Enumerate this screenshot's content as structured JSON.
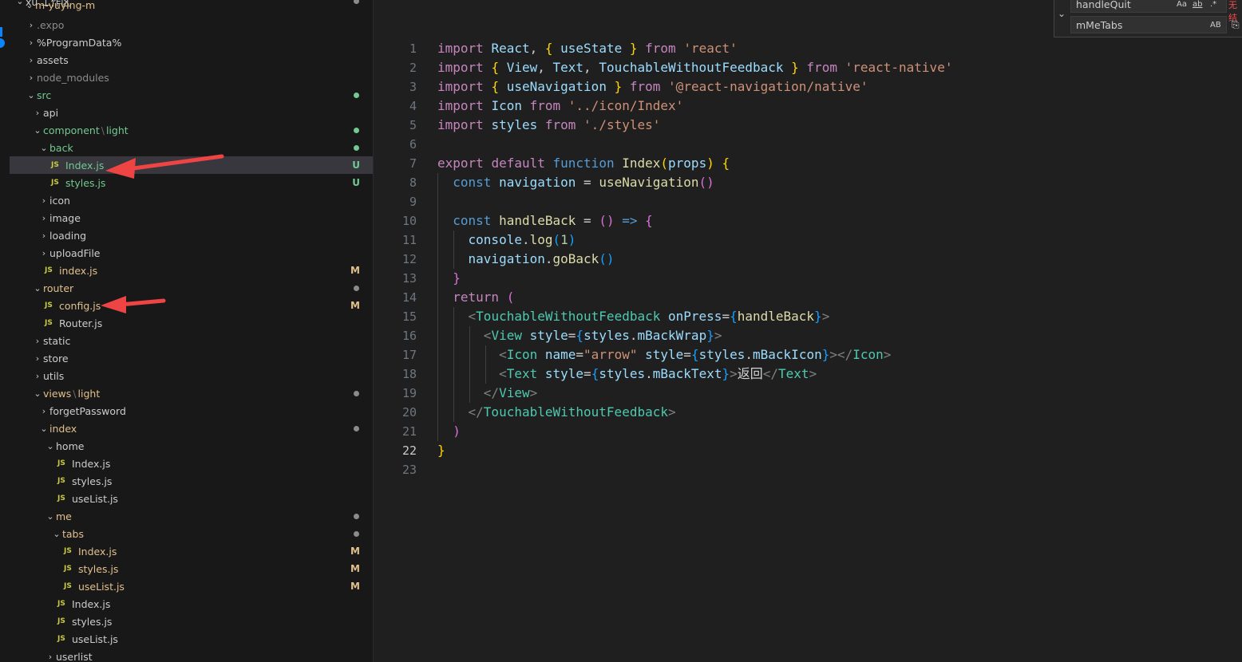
{
  "explorer": {
    "root_label": "xü 工作区",
    "project": "m-yuying-m",
    "items": [
      {
        "name": ".expo",
        "type": "folder",
        "expanded": false,
        "depth": 1,
        "color": "dim"
      },
      {
        "name": "%ProgramData%",
        "type": "folder",
        "expanded": false,
        "depth": 1,
        "color": "white"
      },
      {
        "name": "assets",
        "type": "folder",
        "expanded": false,
        "depth": 1,
        "color": "white"
      },
      {
        "name": "node_modules",
        "type": "folder",
        "expanded": false,
        "depth": 1,
        "color": "dim"
      },
      {
        "name": "src",
        "type": "folder",
        "expanded": true,
        "depth": 1,
        "color": "green",
        "dot": "#73c991"
      },
      {
        "name": "api",
        "type": "folder",
        "expanded": false,
        "depth": 2,
        "color": "white"
      },
      {
        "name": "component",
        "suffix": "light",
        "type": "folder",
        "expanded": true,
        "depth": 2,
        "color": "green",
        "dot": "#73c991"
      },
      {
        "name": "back",
        "type": "folder",
        "expanded": true,
        "depth": 3,
        "color": "green",
        "dot": "#73c991"
      },
      {
        "name": "Index.js",
        "type": "file",
        "depth": 4,
        "color": "green",
        "status": "U",
        "status_color": "#73c991",
        "selected": true
      },
      {
        "name": "styles.js",
        "type": "file",
        "depth": 4,
        "color": "green",
        "status": "U",
        "status_color": "#73c991"
      },
      {
        "name": "icon",
        "type": "folder",
        "expanded": false,
        "depth": 3,
        "color": "white"
      },
      {
        "name": "image",
        "type": "folder",
        "expanded": false,
        "depth": 3,
        "color": "white"
      },
      {
        "name": "loading",
        "type": "folder",
        "expanded": false,
        "depth": 3,
        "color": "white"
      },
      {
        "name": "uploadFile",
        "type": "folder",
        "expanded": false,
        "depth": 3,
        "color": "white"
      },
      {
        "name": "index.js",
        "type": "file",
        "depth": 3,
        "color": "yellow",
        "status": "M",
        "status_color": "#e2c08d"
      },
      {
        "name": "router",
        "type": "folder",
        "expanded": true,
        "depth": 2,
        "color": "yellow",
        "dot": "#8b8b8b"
      },
      {
        "name": "config.js",
        "type": "file",
        "depth": 3,
        "color": "yellow",
        "status": "M",
        "status_color": "#e2c08d"
      },
      {
        "name": "Router.js",
        "type": "file",
        "depth": 3,
        "color": "white"
      },
      {
        "name": "static",
        "type": "folder",
        "expanded": false,
        "depth": 2,
        "color": "white"
      },
      {
        "name": "store",
        "type": "folder",
        "expanded": false,
        "depth": 2,
        "color": "white"
      },
      {
        "name": "utils",
        "type": "folder",
        "expanded": false,
        "depth": 2,
        "color": "white"
      },
      {
        "name": "views",
        "suffix": "light",
        "type": "folder",
        "expanded": true,
        "depth": 2,
        "color": "yellow",
        "dot": "#8b8b8b"
      },
      {
        "name": "forgetPassword",
        "type": "folder",
        "expanded": false,
        "depth": 3,
        "color": "white"
      },
      {
        "name": "index",
        "type": "folder",
        "expanded": true,
        "depth": 3,
        "color": "yellow",
        "dot": "#8b8b8b"
      },
      {
        "name": "home",
        "type": "folder",
        "expanded": true,
        "depth": 4,
        "color": "white"
      },
      {
        "name": "Index.js",
        "type": "file",
        "depth": 5,
        "color": "white"
      },
      {
        "name": "styles.js",
        "type": "file",
        "depth": 5,
        "color": "white"
      },
      {
        "name": "useList.js",
        "type": "file",
        "depth": 5,
        "color": "white"
      },
      {
        "name": "me",
        "type": "folder",
        "expanded": true,
        "depth": 4,
        "color": "yellow",
        "dot": "#8b8b8b"
      },
      {
        "name": "tabs",
        "type": "folder",
        "expanded": true,
        "depth": 5,
        "color": "yellow",
        "dot": "#8b8b8b"
      },
      {
        "name": "Index.js",
        "type": "file",
        "depth": 6,
        "color": "yellow",
        "status": "M",
        "status_color": "#e2c08d"
      },
      {
        "name": "styles.js",
        "type": "file",
        "depth": 6,
        "color": "yellow",
        "status": "M",
        "status_color": "#e2c08d"
      },
      {
        "name": "useList.js",
        "type": "file",
        "depth": 6,
        "color": "yellow",
        "status": "M",
        "status_color": "#e2c08d"
      },
      {
        "name": "Index.js",
        "type": "file",
        "depth": 5,
        "color": "white"
      },
      {
        "name": "styles.js",
        "type": "file",
        "depth": 5,
        "color": "white"
      },
      {
        "name": "useList.js",
        "type": "file",
        "depth": 5,
        "color": "white"
      },
      {
        "name": "userlist",
        "type": "folder",
        "expanded": false,
        "depth": 4,
        "color": "white"
      }
    ]
  },
  "find_widget": {
    "find_value": "handleQuit",
    "replace_value": "mMeTabs",
    "opt_case": "Aa",
    "opt_word": "ab",
    "opt_regex": ".*",
    "opt_preserve": "AB",
    "no_results": "无结"
  },
  "editor": {
    "current_line": 22,
    "lines": [
      [
        [
          "kw",
          "import"
        ],
        [
          "pun",
          " "
        ],
        [
          "id",
          "React"
        ],
        [
          "pun",
          ", "
        ],
        [
          "br1",
          "{"
        ],
        [
          "pun",
          " "
        ],
        [
          "id",
          "useState"
        ],
        [
          "pun",
          " "
        ],
        [
          "br1",
          "}"
        ],
        [
          "pun",
          " "
        ],
        [
          "kw",
          "from"
        ],
        [
          "pun",
          " "
        ],
        [
          "str",
          "'react'"
        ]
      ],
      [
        [
          "kw",
          "import"
        ],
        [
          "pun",
          " "
        ],
        [
          "br1",
          "{"
        ],
        [
          "pun",
          " "
        ],
        [
          "id",
          "View"
        ],
        [
          "pun",
          ", "
        ],
        [
          "id",
          "Text"
        ],
        [
          "pun",
          ", "
        ],
        [
          "id",
          "TouchableWithoutFeedback"
        ],
        [
          "pun",
          " "
        ],
        [
          "br1",
          "}"
        ],
        [
          "pun",
          " "
        ],
        [
          "kw",
          "from"
        ],
        [
          "pun",
          " "
        ],
        [
          "str",
          "'react-native'"
        ]
      ],
      [
        [
          "kw",
          "import"
        ],
        [
          "pun",
          " "
        ],
        [
          "br1",
          "{"
        ],
        [
          "pun",
          " "
        ],
        [
          "id",
          "useNavigation"
        ],
        [
          "pun",
          " "
        ],
        [
          "br1",
          "}"
        ],
        [
          "pun",
          " "
        ],
        [
          "kw",
          "from"
        ],
        [
          "pun",
          " "
        ],
        [
          "str",
          "'@react-navigation/native'"
        ]
      ],
      [
        [
          "kw",
          "import"
        ],
        [
          "pun",
          " "
        ],
        [
          "id",
          "Icon"
        ],
        [
          "pun",
          " "
        ],
        [
          "kw",
          "from"
        ],
        [
          "pun",
          " "
        ],
        [
          "str",
          "'../icon/Index'"
        ]
      ],
      [
        [
          "kw",
          "import"
        ],
        [
          "pun",
          " "
        ],
        [
          "id",
          "styles"
        ],
        [
          "pun",
          " "
        ],
        [
          "kw",
          "from"
        ],
        [
          "pun",
          " "
        ],
        [
          "str",
          "'./styles'"
        ]
      ],
      [],
      [
        [
          "kw",
          "export"
        ],
        [
          "pun",
          " "
        ],
        [
          "kw",
          "default"
        ],
        [
          "pun",
          " "
        ],
        [
          "kw2",
          "function"
        ],
        [
          "pun",
          " "
        ],
        [
          "fn",
          "Index"
        ],
        [
          "br1",
          "("
        ],
        [
          "id",
          "props"
        ],
        [
          "br1",
          ")"
        ],
        [
          "pun",
          " "
        ],
        [
          "br1",
          "{"
        ]
      ],
      [
        [
          "pun",
          "  "
        ],
        [
          "kw2",
          "const"
        ],
        [
          "pun",
          " "
        ],
        [
          "id",
          "navigation"
        ],
        [
          "pun",
          " = "
        ],
        [
          "fn",
          "useNavigation"
        ],
        [
          "br2",
          "()"
        ]
      ],
      [],
      [
        [
          "pun",
          "  "
        ],
        [
          "kw2",
          "const"
        ],
        [
          "pun",
          " "
        ],
        [
          "fn",
          "handleBack"
        ],
        [
          "pun",
          " = "
        ],
        [
          "br2",
          "()"
        ],
        [
          "pun",
          " "
        ],
        [
          "kw2",
          "=>"
        ],
        [
          "pun",
          " "
        ],
        [
          "br2",
          "{"
        ]
      ],
      [
        [
          "pun",
          "    "
        ],
        [
          "id",
          "console"
        ],
        [
          "pun",
          "."
        ],
        [
          "fn",
          "log"
        ],
        [
          "br3",
          "("
        ],
        [
          "num",
          "1"
        ],
        [
          "br3",
          ")"
        ]
      ],
      [
        [
          "pun",
          "    "
        ],
        [
          "id",
          "navigation"
        ],
        [
          "pun",
          "."
        ],
        [
          "fn",
          "goBack"
        ],
        [
          "br3",
          "()"
        ]
      ],
      [
        [
          "pun",
          "  "
        ],
        [
          "br2",
          "}"
        ]
      ],
      [
        [
          "pun",
          "  "
        ],
        [
          "kw",
          "return"
        ],
        [
          "pun",
          " "
        ],
        [
          "br2",
          "("
        ]
      ],
      [
        [
          "pun",
          "    "
        ],
        [
          "lt",
          "<"
        ],
        [
          "tag",
          "TouchableWithoutFeedback"
        ],
        [
          "pun",
          " "
        ],
        [
          "attr",
          "onPress"
        ],
        [
          "pun",
          "="
        ],
        [
          "br3",
          "{"
        ],
        [
          "fn",
          "handleBack"
        ],
        [
          "br3",
          "}"
        ],
        [
          "lt",
          ">"
        ]
      ],
      [
        [
          "pun",
          "      "
        ],
        [
          "lt",
          "<"
        ],
        [
          "tag",
          "View"
        ],
        [
          "pun",
          " "
        ],
        [
          "attr",
          "style"
        ],
        [
          "pun",
          "="
        ],
        [
          "br3",
          "{"
        ],
        [
          "id",
          "styles"
        ],
        [
          "pun",
          "."
        ],
        [
          "id",
          "mBackWrap"
        ],
        [
          "br3",
          "}"
        ],
        [
          "lt",
          ">"
        ]
      ],
      [
        [
          "pun",
          "        "
        ],
        [
          "lt",
          "<"
        ],
        [
          "tag",
          "Icon"
        ],
        [
          "pun",
          " "
        ],
        [
          "attr",
          "name"
        ],
        [
          "pun",
          "="
        ],
        [
          "str",
          "\"arrow\""
        ],
        [
          "pun",
          " "
        ],
        [
          "attr",
          "style"
        ],
        [
          "pun",
          "="
        ],
        [
          "br3",
          "{"
        ],
        [
          "id",
          "styles"
        ],
        [
          "pun",
          "."
        ],
        [
          "id",
          "mBackIcon"
        ],
        [
          "br3",
          "}"
        ],
        [
          "lt",
          "></"
        ],
        [
          "tag",
          "Icon"
        ],
        [
          "lt",
          ">"
        ]
      ],
      [
        [
          "pun",
          "        "
        ],
        [
          "lt",
          "<"
        ],
        [
          "tag",
          "Text"
        ],
        [
          "pun",
          " "
        ],
        [
          "attr",
          "style"
        ],
        [
          "pun",
          "="
        ],
        [
          "br3",
          "{"
        ],
        [
          "id",
          "styles"
        ],
        [
          "pun",
          "."
        ],
        [
          "id",
          "mBackText"
        ],
        [
          "br3",
          "}"
        ],
        [
          "lt",
          ">"
        ],
        [
          "txt",
          "返回"
        ],
        [
          "lt",
          "</"
        ],
        [
          "tag",
          "Text"
        ],
        [
          "lt",
          ">"
        ]
      ],
      [
        [
          "pun",
          "      "
        ],
        [
          "lt",
          "</"
        ],
        [
          "tag",
          "View"
        ],
        [
          "lt",
          ">"
        ]
      ],
      [
        [
          "pun",
          "    "
        ],
        [
          "lt",
          "</"
        ],
        [
          "tag",
          "TouchableWithoutFeedback"
        ],
        [
          "lt",
          ">"
        ]
      ],
      [
        [
          "pun",
          "  "
        ],
        [
          "br2",
          ")"
        ]
      ],
      [
        [
          "br1",
          "}"
        ]
      ],
      []
    ]
  },
  "annotations": {
    "arrow_color": "#ef4444"
  }
}
